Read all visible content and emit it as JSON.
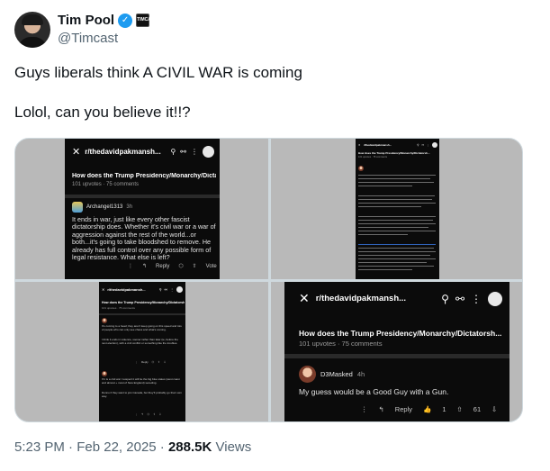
{
  "author": {
    "display_name": "Tim Pool",
    "handle": "@Timcast",
    "verified_icon": "verified-check-icon",
    "affiliate_badge": "TIMCAST"
  },
  "tweet": {
    "line1": "Guys liberals think A CIVIL WAR is coming",
    "line2": "Lolol, can you believe it!!?"
  },
  "meta": {
    "time": "5:23 PM",
    "date": "Feb 22, 2025",
    "views_count": "288.5K",
    "views_label": "Views"
  },
  "screens": {
    "s1": {
      "subreddit": "r/thedavidpakmansh...",
      "title": "How does the Trump Presidency/Monarchy/Dictatorsh...",
      "upvotes": "101 upvotes",
      "comments": "75 comments",
      "commenter": "Archangel1313",
      "age": "3h",
      "comment": "It ends in war, just like every other fascist dictatorship does. Whether it's civil war or a war of aggression against the rest of the world...or both...it's going to take bloodshed to remove. He already has full control over any possible form of legal resistance. What else is left?",
      "reply": "Reply",
      "vote": "Vote"
    },
    "s3": {
      "subreddit": "r/thedavidpakmansh...",
      "title": "How does the Trump Presidency/Monarchy/Dictatorsh...",
      "meta": "101 upvotes · 75 comments",
      "c1_text": "It's coming to a head; they aren't keep going on this speed and lots of people who can only see chaos and what's coming.",
      "c1_text2": "I think it ends in violence, sooner rather than later (ie, before the next election), with a civil conflict or something like the troubles.",
      "c2_text": "If it is a civil war I suspect it will be the big blue states (west coast and almost + most of New England) seceding.",
      "c2_text2": "Dunno if they want to join Canada, but they'll probably go their own way.",
      "reply": "Reply"
    },
    "s4": {
      "subreddit": "r/thedavidpakmansh...",
      "title": "How does the Trump Presidency/Monarchy/Dictatorsh...",
      "upvotes": "101 upvotes",
      "comments": "75 comments",
      "commenter": "D3Masked",
      "age": "4h",
      "comment": "My guess would be a Good Guy with a Gun.",
      "reply": "Reply",
      "up_count": "1",
      "vote_count": "61"
    }
  },
  "colors": {
    "text": "#0f1419",
    "muted": "#536471",
    "verified": "#1d9bf0",
    "reddit_bg": "#0b0b0b"
  }
}
